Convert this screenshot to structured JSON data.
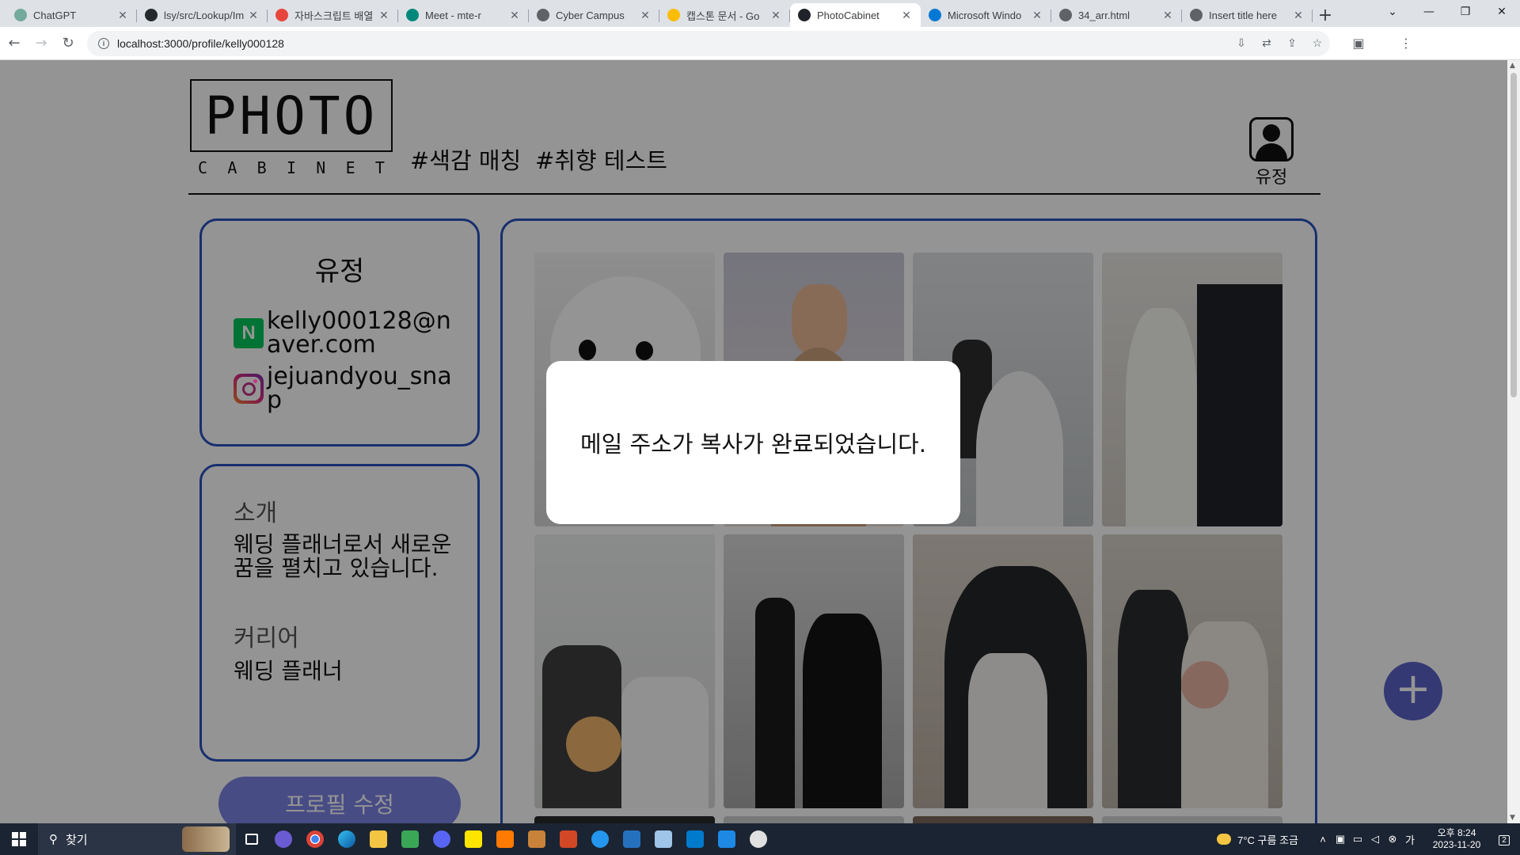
{
  "browser": {
    "tabs": [
      {
        "title": "ChatGPT",
        "icon": "openai-icon",
        "color": "#74aa9c"
      },
      {
        "title": "lsy/src/Lookup/Im",
        "icon": "github-icon",
        "color": "#24292e"
      },
      {
        "title": "자바스크립트 배열",
        "icon": "site-icon",
        "color": "#e8453c"
      },
      {
        "title": "Meet - mte-r",
        "icon": "meet-icon",
        "color": "#00897b"
      },
      {
        "title": "Cyber Campus",
        "icon": "globe-icon",
        "color": "#5f6368"
      },
      {
        "title": "캡스톤 문서 - Go",
        "icon": "drive-icon",
        "color": "#fbbc04"
      },
      {
        "title": "PhotoCabinet",
        "icon": "react-icon",
        "color": "#20232a"
      },
      {
        "title": "Microsoft Windo",
        "icon": "edge-icon",
        "color": "#0078d4"
      },
      {
        "title": "34_arr.html",
        "icon": "globe-icon",
        "color": "#5f6368"
      },
      {
        "title": "Insert title here",
        "icon": "globe-icon",
        "color": "#5f6368"
      }
    ],
    "active_tab": 6,
    "new_tab": "+",
    "url": "localhost:3000/profile/kelly000128"
  },
  "header": {
    "logo_main": "PHOTO",
    "logo_sub": [
      "C",
      "A",
      "B",
      "I",
      "N",
      "E",
      "T"
    ],
    "nav": [
      "#색감 매칭",
      "#취향 테스트"
    ],
    "profile_label": "유정"
  },
  "profile": {
    "name": "유정",
    "email": "kelly000128@naver.com",
    "instagram": "jejuandyou_snap"
  },
  "about": {
    "intro_heading": "소개",
    "intro_text": "웨딩 플래너로서 새로운 꿈을 펼치고 있습니다.",
    "career_heading": "커리어",
    "career_text": "웨딩 플래너"
  },
  "actions": {
    "edit_profile": "프로필 수정",
    "add": "+"
  },
  "modal": {
    "message": "메일 주소가 복사가 완료되었습니다."
  },
  "taskbar": {
    "search_placeholder": "찾기",
    "weather": "7°C  구름 조금",
    "time": "오후 8:24",
    "date": "2023-11-20",
    "notifications": "2"
  },
  "colors": {
    "accent": "#2a52be",
    "button": "#7b83e6",
    "fab": "#5a63c9"
  }
}
